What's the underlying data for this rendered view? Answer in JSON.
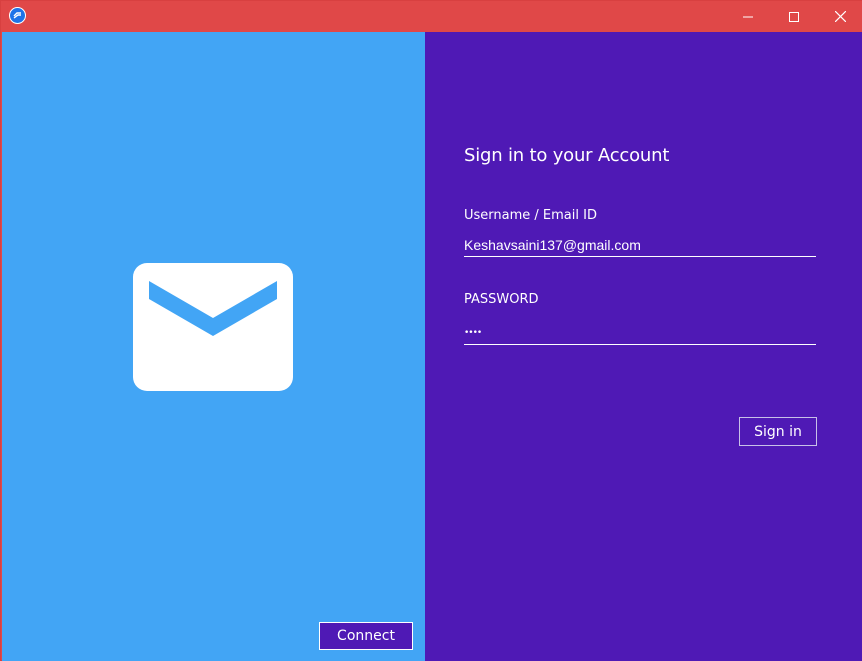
{
  "window": {
    "title_bar_color": "#e04848",
    "controls": {
      "minimize_icon": "minimize-icon",
      "maximize_icon": "maximize-icon",
      "close_icon": "close-icon"
    },
    "app_icon": "app-icon"
  },
  "left_panel": {
    "background": "#42a5f5",
    "illustration_icon": "envelope-icon",
    "connect_label": "Connect"
  },
  "right_panel": {
    "background": "#4f19b5",
    "heading": "Sign in to your Account",
    "username": {
      "label": "Username / Email ID",
      "value": "Keshavsaini137@gmail.com"
    },
    "password": {
      "label": "PASSWORD",
      "value": "••••"
    },
    "signin_label": "Sign in"
  }
}
